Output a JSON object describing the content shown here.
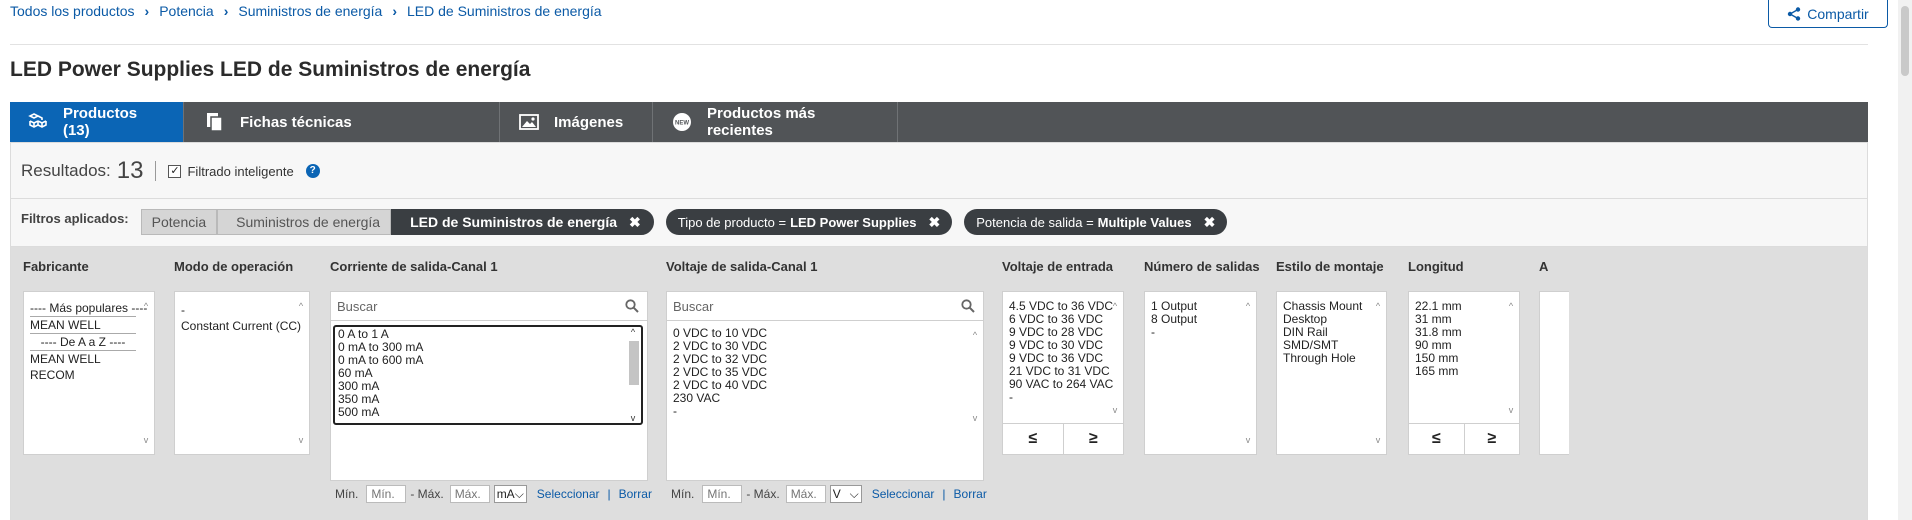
{
  "breadcrumb": [
    "Todos los productos",
    "Potencia",
    "Suministros de energía",
    "LED de Suministros de energía"
  ],
  "share_label": "Compartir",
  "page_title": "LED Power Supplies LED de Suministros de energía",
  "tabs": [
    {
      "label": "Productos (13)",
      "icon": "boxes-icon",
      "active": true
    },
    {
      "label": "Fichas técnicas",
      "icon": "documents-icon",
      "active": false
    },
    {
      "label": "Imágenes",
      "icon": "image-icon",
      "active": false
    },
    {
      "label": "Productos más recientes",
      "icon": "new-badge-icon",
      "active": false
    }
  ],
  "results": {
    "label": "Resultados:",
    "count": "13",
    "smart_filter_label": "Filtrado inteligente",
    "smart_filter_checked": true
  },
  "applied": {
    "label": "Filtros aplicados:",
    "crumbs": [
      "Potencia",
      "Suministros de energía",
      "LED de Suministros de energía"
    ],
    "pills": [
      {
        "name": "Tipo de producto = ",
        "value": "LED Power Supplies"
      },
      {
        "name": "Potencia de salida = ",
        "value": "Multiple Values"
      }
    ]
  },
  "filters": {
    "fabricante": {
      "title": "Fabricante",
      "items": [
        "---- Más populares ----",
        "MEAN WELL",
        "---- De A a Z ----",
        "MEAN WELL",
        "RECOM"
      ]
    },
    "modo": {
      "title": "Modo de operación",
      "items": [
        "-",
        "Constant Current (CC)"
      ]
    },
    "corriente": {
      "title": "Corriente de salida-Canal 1",
      "search_placeholder": "Buscar",
      "items": [
        "0 A to 1 A",
        "0 mA to 300 mA",
        "0 mA to 600 mA",
        "60 mA",
        "300 mA",
        "350 mA",
        "500 mA"
      ],
      "min_label": "Mín.",
      "min_placeholder": "Mín.",
      "max_label": "- Máx.",
      "max_placeholder": "Máx.",
      "unit": "mA",
      "select_label": "Seleccionar",
      "clear_label": "Borrar"
    },
    "voltaje_salida": {
      "title": "Voltaje de salida-Canal 1",
      "search_placeholder": "Buscar",
      "items": [
        "0 VDC to 10 VDC",
        "2 VDC to 30 VDC",
        "2 VDC to 32 VDC",
        "2 VDC to 35 VDC",
        "2 VDC to 40 VDC",
        "230 VAC",
        "-"
      ],
      "min_label": "Mín.",
      "min_placeholder": "Mín.",
      "max_label": "- Máx.",
      "max_placeholder": "Máx.",
      "unit": "V",
      "select_label": "Seleccionar",
      "clear_label": "Borrar"
    },
    "voltaje_entrada": {
      "title": "Voltaje de entrada",
      "items": [
        "4.5 VDC to 36 VDC",
        "6 VDC to 36 VDC",
        "9 VDC to 28 VDC",
        "9 VDC to 30 VDC",
        "9 VDC to 36 VDC",
        "21 VDC to 31 VDC",
        "90 VAC to 264 VAC",
        "-"
      ],
      "lte": "≤",
      "gte": "≥"
    },
    "numero_salidas": {
      "title": "Número de salidas",
      "items": [
        "1 Output",
        "8 Output",
        "-"
      ]
    },
    "montaje": {
      "title": "Estilo de montaje",
      "items": [
        "Chassis Mount",
        "Desktop",
        "DIN Rail",
        "SMD/SMT",
        "Through Hole"
      ]
    },
    "longitud": {
      "title": "Longitud",
      "items": [
        "22.1 mm",
        "31 mm",
        "31.8 mm",
        "90 mm",
        "150 mm",
        "165 mm"
      ],
      "lte": "≤",
      "gte": "≥"
    },
    "next_partial": {
      "title": "A"
    }
  },
  "colors": {
    "link": "#0b5aa6",
    "active_tab": "#0b65b5",
    "tab_bar": "#515457",
    "chip_dark": "#3a3e42"
  }
}
